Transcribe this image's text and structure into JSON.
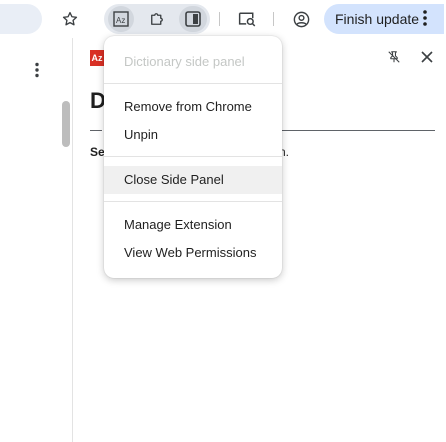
{
  "toolbar": {
    "bookmark_icon": "star-icon",
    "extension_icons": [
      "dictionary-icon",
      "puzzle-icon",
      "side-panel-icon"
    ],
    "extra_icons": [
      "search-tab-icon",
      "profile-icon"
    ],
    "finish_update_label": "Finish update",
    "menu_icon": "vertical-dots-icon"
  },
  "side_panel": {
    "logo_text": "Az",
    "heading_text": "D",
    "sub_text": "Se",
    "trailing_text": "n."
  },
  "context_menu": {
    "title": "Dictionary side panel",
    "items_group1": [
      "Remove from Chrome",
      "Unpin"
    ],
    "items_group2": [
      "Close Side Panel"
    ],
    "items_group3": [
      "Manage Extension",
      "View Web Permissions"
    ]
  },
  "colors": {
    "accent": "#d3e3fd",
    "pill": "#e4e8ee",
    "logo_red": "#d93025"
  }
}
